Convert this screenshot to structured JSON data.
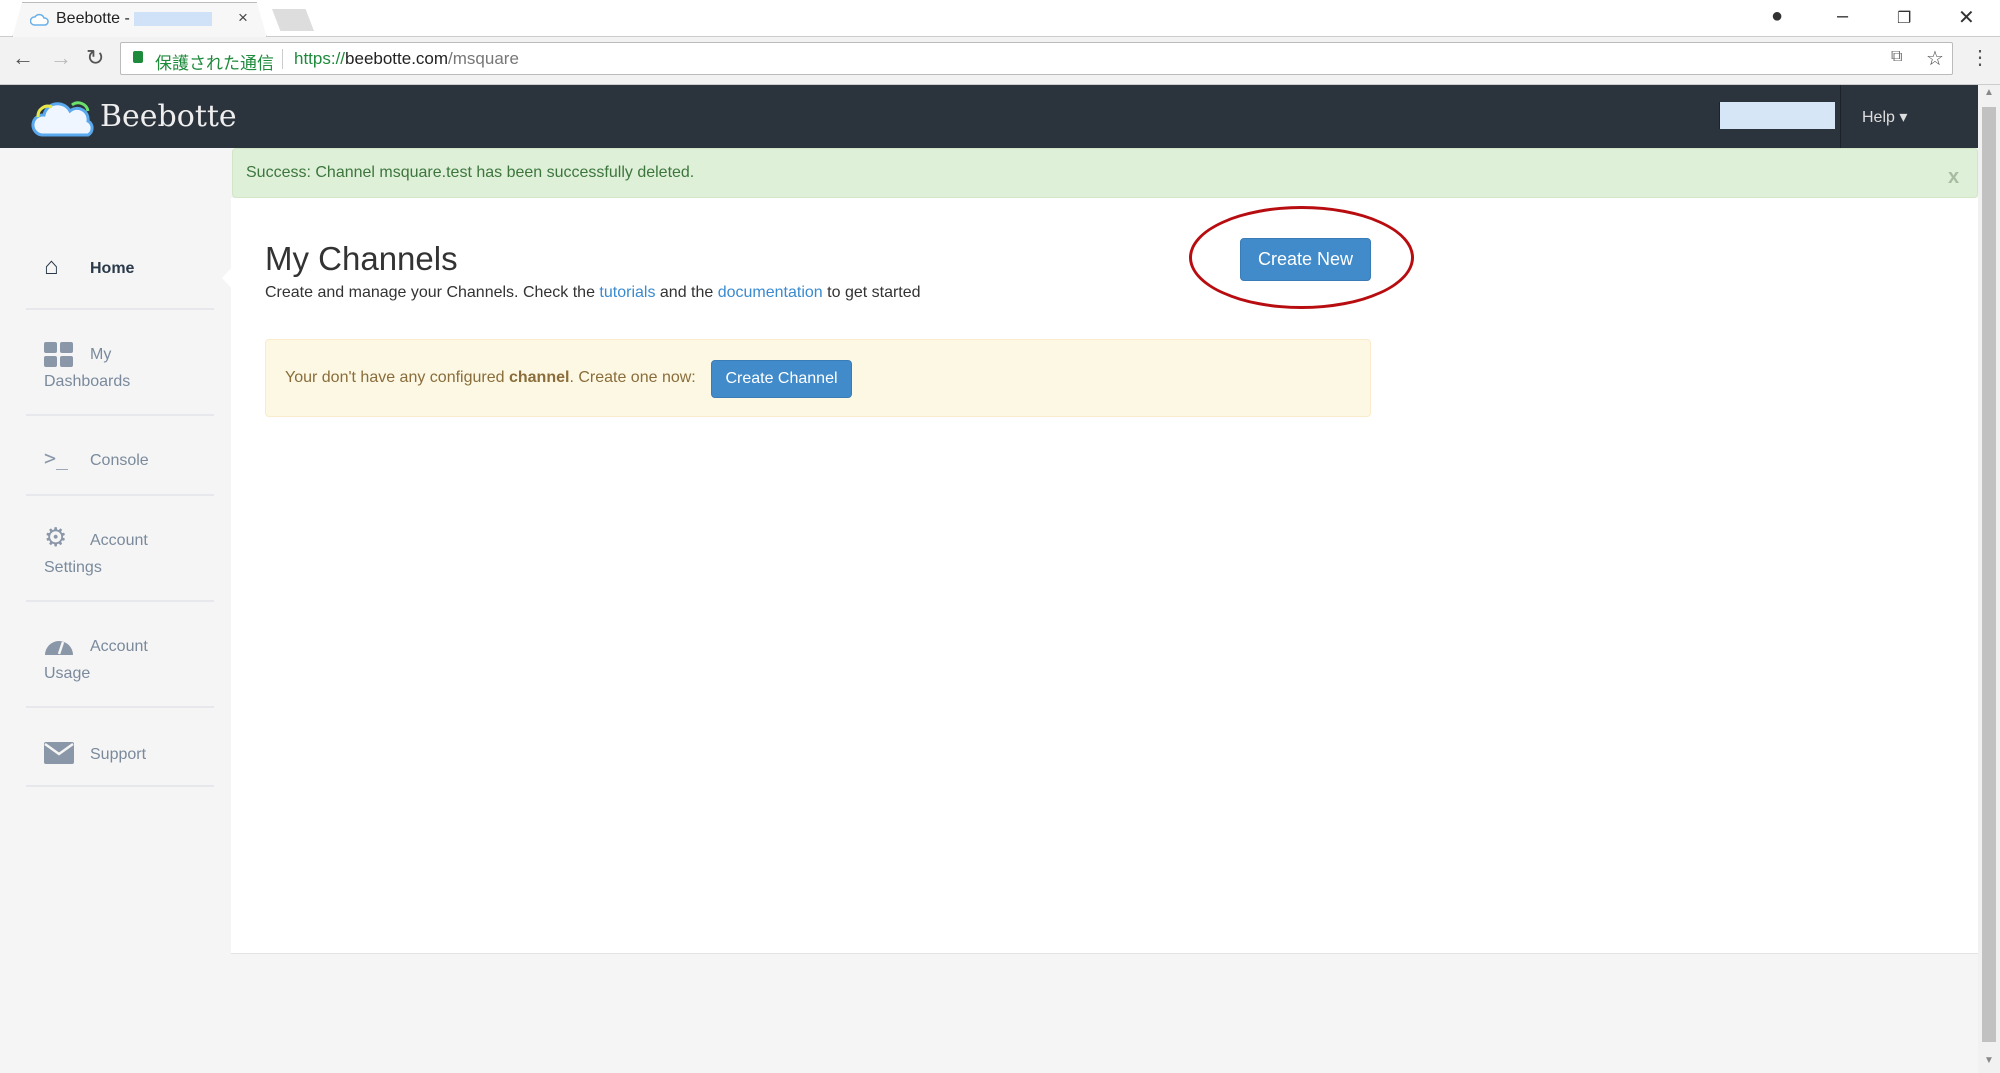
{
  "browser": {
    "tab_title": "Beebotte - ",
    "secure_label": "保護された通信",
    "url_scheme": "https://",
    "url_host": "beebotte.com",
    "url_path": "/msquare"
  },
  "navbar": {
    "brand": "Beebotte",
    "help_label": "Help ▾"
  },
  "sidebar": {
    "items": [
      {
        "icon": "home-icon",
        "line1": "Home",
        "line2": ""
      },
      {
        "icon": "dashboard-icon",
        "line1": "My",
        "line2": "Dashboards"
      },
      {
        "icon": "console-icon",
        "line1": "Console",
        "line2": ""
      },
      {
        "icon": "gears-icon",
        "line1": "Account",
        "line2": "Settings"
      },
      {
        "icon": "gauge-icon",
        "line1": "Account",
        "line2": "Usage"
      },
      {
        "icon": "envelope-icon",
        "line1": "Support",
        "line2": ""
      }
    ]
  },
  "alert": {
    "text": "Success: Channel msquare.test has been successfully deleted.",
    "close": "x"
  },
  "main": {
    "title": "My Channels",
    "subtitle_pre": "Create and manage your Channels. Check the ",
    "link_tutorials": "tutorials",
    "subtitle_mid": " and the ",
    "link_docs": "documentation",
    "subtitle_post": " to get started",
    "create_new": "Create New",
    "warning_pre": "Your don't have any configured ",
    "warning_bold": "channel",
    "warning_post": ". Create one now: ",
    "create_channel": "Create Channel"
  },
  "colors": {
    "navbar": "#2b333d",
    "primary": "#428bca",
    "highlight": "#b80d10"
  }
}
